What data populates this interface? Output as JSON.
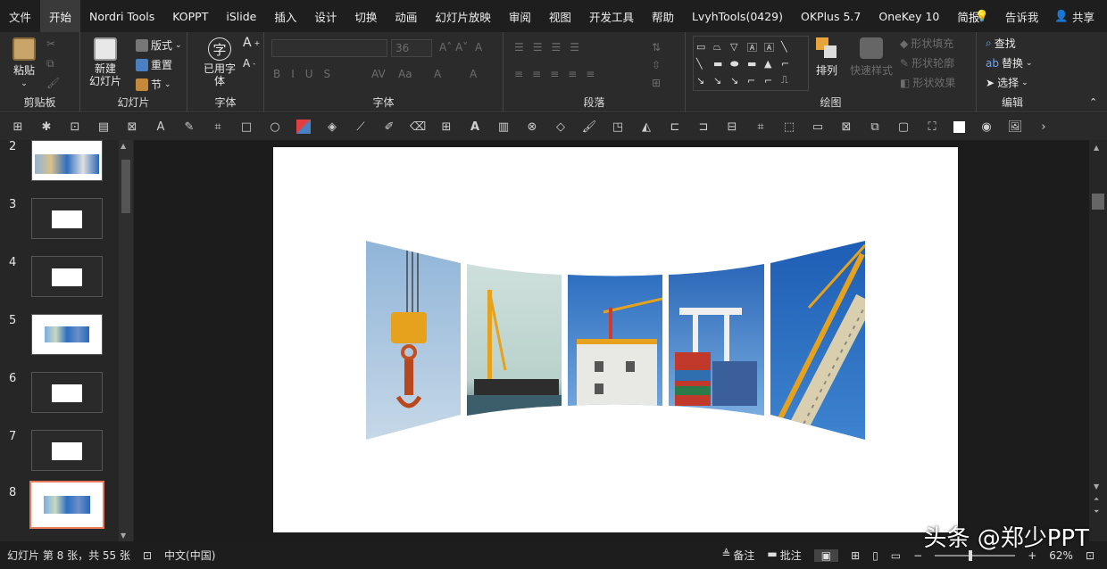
{
  "menubar": {
    "tabs": [
      "文件",
      "开始",
      "Nordri Tools",
      "KOPPT",
      "iSlide",
      "插入",
      "设计",
      "切换",
      "动画",
      "幻灯片放映",
      "审阅",
      "视图",
      "开发工具",
      "帮助",
      "LvyhTools(0429)",
      "OKPlus 5.7",
      "OneKey 10",
      "简报"
    ],
    "tell_me": "告诉我",
    "share": "共享"
  },
  "ribbon": {
    "clipboard": {
      "label": "剪贴板",
      "paste": "粘贴"
    },
    "slides": {
      "label": "幻灯片",
      "new_slide": "新建\n幻灯片",
      "layout": "版式",
      "reset": "重置",
      "section": "节"
    },
    "font_group": {
      "label": "字体",
      "used_font": "已用字\n体"
    },
    "font": {
      "label": "字体",
      "size": "36"
    },
    "paragraph": {
      "label": "段落"
    },
    "drawing": {
      "label": "绘图",
      "arrange": "排列",
      "quick_styles": "快速样式",
      "fill": "形状填充",
      "outline": "形状轮廓",
      "effects": "形状效果"
    },
    "editing": {
      "label": "编辑",
      "find": "查找",
      "replace": "替换",
      "select": "选择"
    }
  },
  "thumbnails": [
    {
      "num": "2"
    },
    {
      "num": "3"
    },
    {
      "num": "4"
    },
    {
      "num": "5"
    },
    {
      "num": "6"
    },
    {
      "num": "7"
    },
    {
      "num": "8"
    }
  ],
  "status": {
    "slide_info": "幻灯片 第 8 张，共 55 张",
    "language": "中文(中国)",
    "notes": "备注",
    "comments": "批注",
    "zoom": "62%"
  },
  "watermark": "头条 @郑少PPT",
  "colors": {
    "accent": "#e8795a",
    "sky": "#2e6fbf",
    "crane": "#e6a21c"
  }
}
